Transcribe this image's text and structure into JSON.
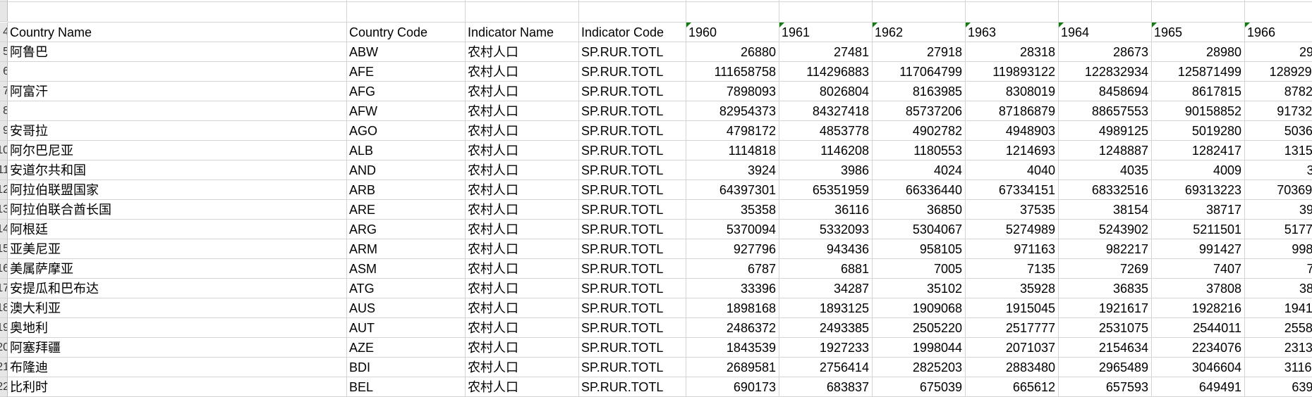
{
  "columns": {
    "headers": [
      "Country Name",
      "Country Code",
      "Indicator Name",
      "Indicator Code",
      "1960",
      "1961",
      "1962",
      "1963",
      "1964",
      "1965",
      "1966"
    ]
  },
  "header_row_number": "4",
  "rows": [
    {
      "n": "5",
      "name": "阿鲁巴",
      "code": "ABW",
      "ind": "农村人口",
      "icode": "SP.RUR.TOTL",
      "v": [
        "26880",
        "27481",
        "27918",
        "28318",
        "28673",
        "28980"
      ],
      "v1966": "29"
    },
    {
      "n": "6",
      "name": "",
      "code": "AFE",
      "ind": "农村人口",
      "icode": "SP.RUR.TOTL",
      "v": [
        "111658758",
        "114296883",
        "117064799",
        "119893122",
        "122832934",
        "125871499"
      ],
      "v1966": "128929"
    },
    {
      "n": "7",
      "name": "阿富汗",
      "code": "AFG",
      "ind": "农村人口",
      "icode": "SP.RUR.TOTL",
      "v": [
        "7898093",
        "8026804",
        "8163985",
        "8308019",
        "8458694",
        "8617815"
      ],
      "v1966": "8782"
    },
    {
      "n": "8",
      "name": "",
      "code": "AFW",
      "ind": "农村人口",
      "icode": "SP.RUR.TOTL",
      "v": [
        "82954373",
        "84327418",
        "85737206",
        "87186879",
        "88657553",
        "90158852"
      ],
      "v1966": "91732"
    },
    {
      "n": "9",
      "name": "安哥拉",
      "code": "AGO",
      "ind": "农村人口",
      "icode": "SP.RUR.TOTL",
      "v": [
        "4798172",
        "4853778",
        "4902782",
        "4948903",
        "4989125",
        "5019280"
      ],
      "v1966": "5036"
    },
    {
      "n": "10",
      "name": "阿尔巴尼亚",
      "code": "ALB",
      "ind": "农村人口",
      "icode": "SP.RUR.TOTL",
      "v": [
        "1114818",
        "1146208",
        "1180553",
        "1214693",
        "1248887",
        "1282417"
      ],
      "v1966": "1315"
    },
    {
      "n": "11",
      "name": "安道尔共和国",
      "code": "AND",
      "ind": "农村人口",
      "icode": "SP.RUR.TOTL",
      "v": [
        "3924",
        "3986",
        "4024",
        "4040",
        "4035",
        "4009"
      ],
      "v1966": "3"
    },
    {
      "n": "12",
      "name": "阿拉伯联盟国家",
      "code": "ARB",
      "ind": "农村人口",
      "icode": "SP.RUR.TOTL",
      "v": [
        "64397301",
        "65351959",
        "66336440",
        "67334151",
        "68332516",
        "69313223"
      ],
      "v1966": "70369"
    },
    {
      "n": "13",
      "name": "阿拉伯联合酋长国",
      "code": "ARE",
      "ind": "农村人口",
      "icode": "SP.RUR.TOTL",
      "v": [
        "35358",
        "36116",
        "36850",
        "37535",
        "38154",
        "38717"
      ],
      "v1966": "39"
    },
    {
      "n": "14",
      "name": "阿根廷",
      "code": "ARG",
      "ind": "农村人口",
      "icode": "SP.RUR.TOTL",
      "v": [
        "5370094",
        "5332093",
        "5304067",
        "5274989",
        "5243902",
        "5211501"
      ],
      "v1966": "5177"
    },
    {
      "n": "15",
      "name": "亚美尼亚",
      "code": "ARM",
      "ind": "农村人口",
      "icode": "SP.RUR.TOTL",
      "v": [
        "927796",
        "943436",
        "958105",
        "971163",
        "982217",
        "991427"
      ],
      "v1966": "998"
    },
    {
      "n": "16",
      "name": "美属萨摩亚",
      "code": "ASM",
      "ind": "农村人口",
      "icode": "SP.RUR.TOTL",
      "v": [
        "6787",
        "6881",
        "7005",
        "7135",
        "7269",
        "7407"
      ],
      "v1966": "7"
    },
    {
      "n": "17",
      "name": "安提瓜和巴布达",
      "code": "ATG",
      "ind": "农村人口",
      "icode": "SP.RUR.TOTL",
      "v": [
        "33396",
        "34287",
        "35102",
        "35928",
        "36835",
        "37808"
      ],
      "v1966": "38"
    },
    {
      "n": "18",
      "name": "澳大利亚",
      "code": "AUS",
      "ind": "农村人口",
      "icode": "SP.RUR.TOTL",
      "v": [
        "1898168",
        "1893125",
        "1909068",
        "1915045",
        "1921617",
        "1928216"
      ],
      "v1966": "1941"
    },
    {
      "n": "19",
      "name": "奥地利",
      "code": "AUT",
      "ind": "农村人口",
      "icode": "SP.RUR.TOTL",
      "v": [
        "2486372",
        "2493385",
        "2505220",
        "2517777",
        "2531075",
        "2544011"
      ],
      "v1966": "2558"
    },
    {
      "n": "20",
      "name": "阿塞拜疆",
      "code": "AZE",
      "ind": "农村人口",
      "icode": "SP.RUR.TOTL",
      "v": [
        "1843539",
        "1927233",
        "1998044",
        "2071037",
        "2154634",
        "2234076"
      ],
      "v1966": "2313"
    },
    {
      "n": "21",
      "name": "布隆迪",
      "code": "BDI",
      "ind": "农村人口",
      "icode": "SP.RUR.TOTL",
      "v": [
        "2689581",
        "2756414",
        "2825203",
        "2883480",
        "2965489",
        "3046604"
      ],
      "v1966": "3116"
    },
    {
      "n": "22",
      "name": "比利时",
      "code": "BEL",
      "ind": "农村人口",
      "icode": "SP.RUR.TOTL",
      "v": [
        "690173",
        "683837",
        "675039",
        "665612",
        "657593",
        "649491"
      ],
      "v1966": "639"
    }
  ]
}
